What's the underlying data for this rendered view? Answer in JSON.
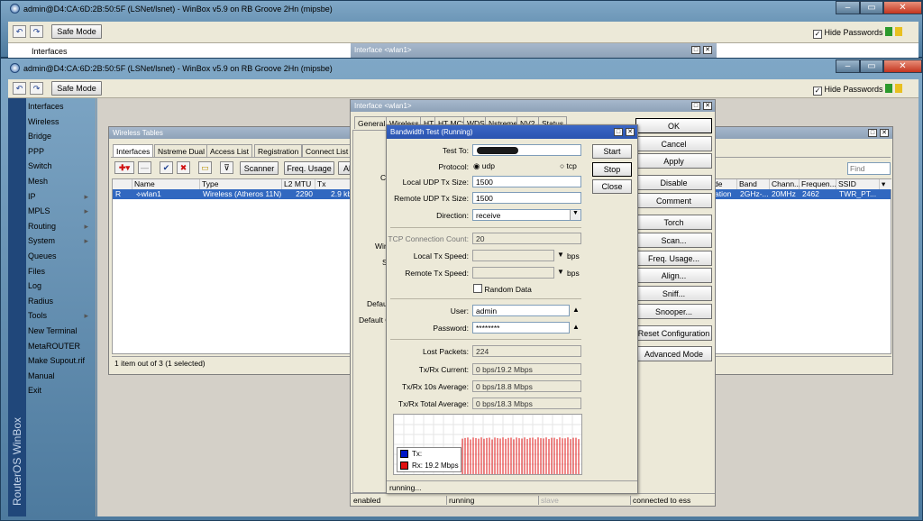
{
  "back_window": {
    "title": "admin@D4:CA:6D:2B:50:5F (LSNet/lsnet) - WinBox v5.9 on RB Groove 2Hn (mipsbe)",
    "safe_mode": "Safe Mode",
    "hide_passwords": "Hide Passwords",
    "menu_item": "Interfaces",
    "iface_title": "Interface <wlan1>"
  },
  "window": {
    "title": "admin@D4:CA:6D:2B:50:5F (LSNet/lsnet) - WinBox v5.9 on RB Groove 2Hn (mipsbe)",
    "safe_mode": "Safe Mode",
    "hide_passwords": "Hide Passwords",
    "brand": "RouterOS WinBox"
  },
  "menu": [
    {
      "label": "Interfaces",
      "arrow": ""
    },
    {
      "label": "Wireless",
      "arrow": ""
    },
    {
      "label": "Bridge",
      "arrow": ""
    },
    {
      "label": "PPP",
      "arrow": ""
    },
    {
      "label": "Switch",
      "arrow": ""
    },
    {
      "label": "Mesh",
      "arrow": ""
    },
    {
      "label": "IP",
      "arrow": "▸"
    },
    {
      "label": "MPLS",
      "arrow": "▸"
    },
    {
      "label": "Routing",
      "arrow": "▸"
    },
    {
      "label": "System",
      "arrow": "▸"
    },
    {
      "label": "Queues",
      "arrow": ""
    },
    {
      "label": "Files",
      "arrow": ""
    },
    {
      "label": "Log",
      "arrow": ""
    },
    {
      "label": "Radius",
      "arrow": ""
    },
    {
      "label": "Tools",
      "arrow": "▸"
    },
    {
      "label": "New Terminal",
      "arrow": ""
    },
    {
      "label": "MetaROUTER",
      "arrow": ""
    },
    {
      "label": "Make Supout.rif",
      "arrow": ""
    },
    {
      "label": "Manual",
      "arrow": ""
    },
    {
      "label": "Exit",
      "arrow": ""
    }
  ],
  "wireless_tables": {
    "title": "Wireless Tables",
    "tabs": [
      "Interfaces",
      "Nstreme Dual",
      "Access List",
      "Registration",
      "Connect List",
      "S"
    ],
    "scanner": "Scanner",
    "freq_usage": "Freq. Usage",
    "al": "Al",
    "find_placeholder": "Find",
    "columns_left": [
      "Name",
      "Type",
      "L2 MTU",
      "Tx"
    ],
    "columns_right": [
      "de",
      "Band",
      "Chann...",
      "Frequen...",
      "SSID"
    ],
    "row": {
      "flag": "R",
      "name": "wlan1",
      "type": "Wireless (Atheros 11N)",
      "mtu": "2290",
      "tx": "2.9 kbp",
      "mode": "ation",
      "band": "2GHz-...",
      "channel": "20MHz",
      "freq": "2462",
      "ssid": "TWR_PT..."
    },
    "status": "1 item out of 3 (1 selected)"
  },
  "iface_window": {
    "title": "Interface <wlan1>",
    "tabs": [
      "General",
      "Wireless",
      "HT",
      "HT MCS",
      "WDS",
      "Nstreme",
      "NV2",
      "Status"
    ],
    "partial_labels": [
      "C",
      "Wire",
      "S",
      "Defaul",
      "Default C"
    ],
    "buttons": [
      "OK",
      "Cancel",
      "Apply",
      "Disable",
      "Comment",
      "Torch",
      "Scan...",
      "Freq. Usage...",
      "Align...",
      "Sniff...",
      "Snooper...",
      "Reset Configuration",
      "Advanced Mode"
    ],
    "status": [
      "enabled",
      "running",
      "slave",
      "connected to ess"
    ]
  },
  "bwtest": {
    "title": "Bandwidth Test (Running)",
    "start": "Start",
    "stop": "Stop",
    "close": "Close",
    "test_to_label": "Test To:",
    "test_to": "",
    "protocol_label": "Protocol:",
    "udp": "udp",
    "tcp": "tcp",
    "local_udp_label": "Local UDP Tx Size:",
    "local_udp": "1500",
    "remote_udp_label": "Remote UDP Tx Size:",
    "remote_udp": "1500",
    "direction_label": "Direction:",
    "direction": "receive",
    "tcp_conn_label": "TCP Connection Count:",
    "tcp_conn": "20",
    "local_speed_label": "Local Tx Speed:",
    "remote_speed_label": "Remote Tx Speed:",
    "bps": "bps",
    "random_data": "Random Data",
    "user_label": "User:",
    "user": "admin",
    "password_label": "Password:",
    "password": "********",
    "lost_label": "Lost Packets:",
    "lost": "224",
    "current_label": "Tx/Rx Current:",
    "current": "0 bps/19.2 Mbps",
    "avg10_label": "Tx/Rx 10s Average:",
    "avg10": "0 bps/18.8 Mbps",
    "total_label": "Tx/Rx Total Average:",
    "total": "0 bps/18.3 Mbps",
    "legend_tx": "Tx:",
    "legend_rx": "Rx:  19.2 Mbps",
    "status": "running...",
    "tx_color": "#0018c8",
    "rx_color": "#e01010"
  },
  "chart_data": {
    "type": "bar",
    "series": [
      {
        "name": "Tx",
        "values": [
          0
        ]
      },
      {
        "name": "Rx",
        "values": [
          19.2
        ]
      }
    ]
  }
}
